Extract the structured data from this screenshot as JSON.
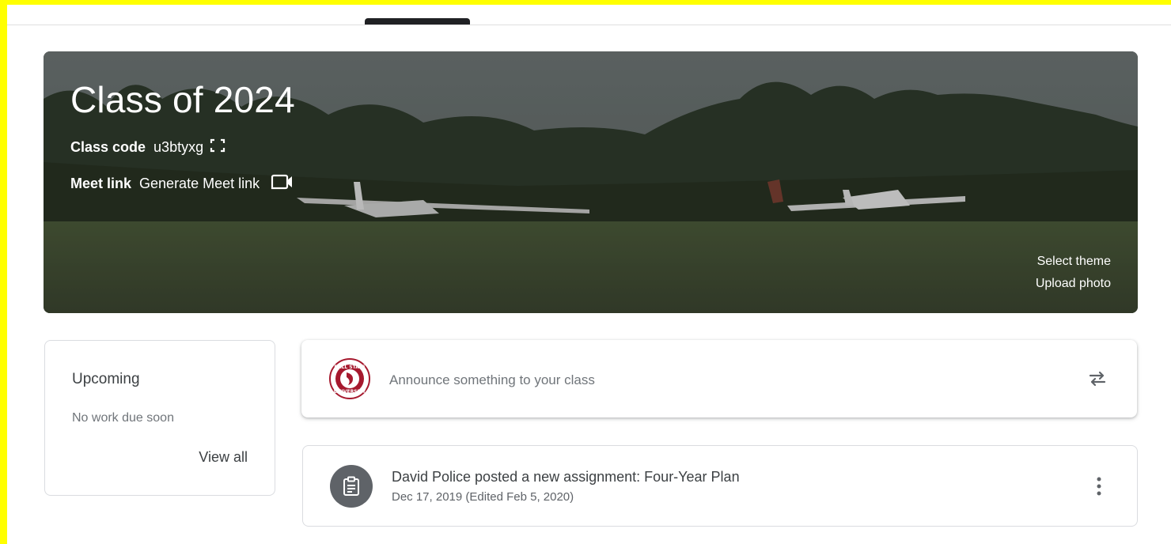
{
  "banner": {
    "title": "Class of 2024",
    "class_code_label": "Class code",
    "class_code_value": "u3btyxg",
    "meet_label": "Meet link",
    "meet_value": "Generate Meet link",
    "select_theme": "Select theme",
    "upload_photo": "Upload photo",
    "icons": {
      "fullscreen": "fullscreen-icon",
      "video": "video-camera-icon"
    }
  },
  "upcoming": {
    "title": "Upcoming",
    "empty_text": "No work due soon",
    "view_all": "View all"
  },
  "announce": {
    "placeholder": "Announce something to your class",
    "avatar_text_top": "BALL STATE",
    "avatar_text_bottom": "UNIVERSITY",
    "icons": {
      "repost": "repost-icon"
    }
  },
  "post": {
    "headline": "David Police posted a new assignment: Four-Year Plan",
    "date": "Dec 17, 2019 (Edited Feb 5, 2020)",
    "icons": {
      "assignment": "assignment-icon",
      "more": "more-vert-icon"
    }
  },
  "colors": {
    "frame": "#ffff00",
    "text_primary": "#3c4043",
    "text_secondary": "#70757a",
    "icon_bg": "#5f6368",
    "avatar_red": "#a6192e"
  }
}
